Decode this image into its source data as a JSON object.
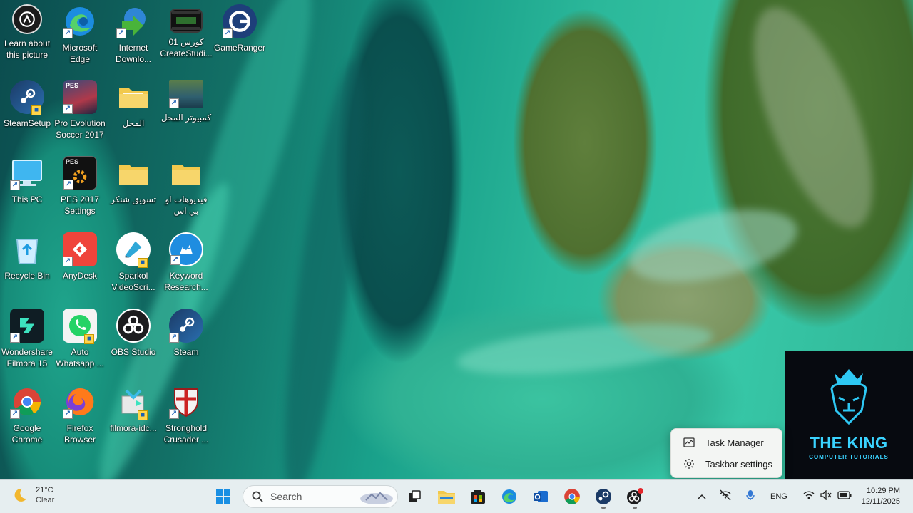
{
  "desktop": {
    "icons": [
      {
        "label": "Learn about this picture"
      },
      {
        "label": "Microsoft Edge"
      },
      {
        "label": "Internet Downlo..."
      },
      {
        "label": "كورس 01 CreateStudi..."
      },
      {
        "label": "GameRanger"
      },
      {
        "label": "SteamSetup"
      },
      {
        "label": "Pro Evolution Soccer 2017"
      },
      {
        "label": "المحل"
      },
      {
        "label": "كمبيوتر المحل"
      },
      {
        "label": "This PC"
      },
      {
        "label": "PES 2017 Settings"
      },
      {
        "label": "تسويق شنكر"
      },
      {
        "label": "فيديوهات او بي اس"
      },
      {
        "label": "Recycle Bin"
      },
      {
        "label": "AnyDesk"
      },
      {
        "label": "Sparkol VideoScri..."
      },
      {
        "label": "Keyword Research..."
      },
      {
        "label": "Wondershare Filmora 15"
      },
      {
        "label": "Auto Whatsapp ..."
      },
      {
        "label": "OBS Studio"
      },
      {
        "label": "Steam"
      },
      {
        "label": "Google Chrome"
      },
      {
        "label": "Firefox Browser"
      },
      {
        "label": "filmora-idc..."
      },
      {
        "label": "Stronghold Crusader ..."
      }
    ]
  },
  "watermark": {
    "title": "THE KING",
    "subtitle": "COMPUTER TUTORIALS",
    "color": "#3ad3ff"
  },
  "context_menu": {
    "items": [
      {
        "label": "Task Manager",
        "icon": "task-manager-icon"
      },
      {
        "label": "Taskbar settings",
        "icon": "gear-icon"
      }
    ]
  },
  "taskbar": {
    "weather": {
      "temp": "21°C",
      "condition": "Clear"
    },
    "search": {
      "placeholder": "Search"
    },
    "pinned": [
      "start",
      "search",
      "task-view",
      "file-explorer",
      "microsoft-store",
      "edge",
      "outlook",
      "chrome",
      "steam",
      "obs-studio"
    ],
    "tray": {
      "language": "ENG"
    },
    "clock": {
      "time": "10:29 PM",
      "date": "12/11/2025"
    }
  }
}
